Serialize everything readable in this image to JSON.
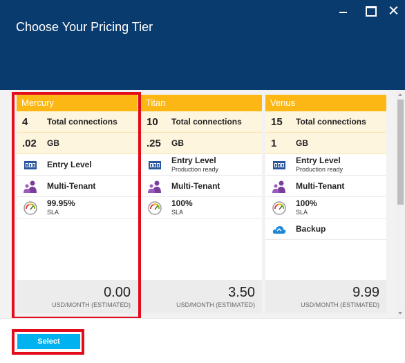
{
  "blade": {
    "title": "Choose Your Pricing Tier"
  },
  "colors": {
    "header": "#0a3b6e",
    "tier_header": "#fcb714",
    "highlight_row": "#fef5de",
    "selection": "#e30c1c",
    "select_button": "#00b3f0"
  },
  "tiers": [
    {
      "name": "Mercury",
      "connections": "4",
      "connections_label": "Total connections",
      "storage": ".02",
      "storage_label": "GB",
      "level": "Entry Level",
      "level_sub": "",
      "tenancy": "Multi-Tenant",
      "sla": "99.95%",
      "sla_label": "SLA",
      "price": "0.00",
      "price_unit": "USD/MONTH (ESTIMATED)"
    },
    {
      "name": "Titan",
      "connections": "10",
      "connections_label": "Total connections",
      "storage": ".25",
      "storage_label": "GB",
      "level": "Entry Level",
      "level_sub": "Production ready",
      "tenancy": "Multi-Tenant",
      "sla": "100%",
      "sla_label": "SLA",
      "price": "3.50",
      "price_unit": "USD/MONTH (ESTIMATED)"
    },
    {
      "name": "Venus",
      "connections": "15",
      "connections_label": "Total connections",
      "storage": "1",
      "storage_label": "GB",
      "level": "Entry Level",
      "level_sub": "Production ready",
      "tenancy": "Multi-Tenant",
      "sla": "100%",
      "sla_label": "SLA",
      "extra": "Backup",
      "price": "9.99",
      "price_unit": "USD/MONTH (ESTIMATED)"
    }
  ],
  "footer": {
    "select_label": "Select"
  }
}
